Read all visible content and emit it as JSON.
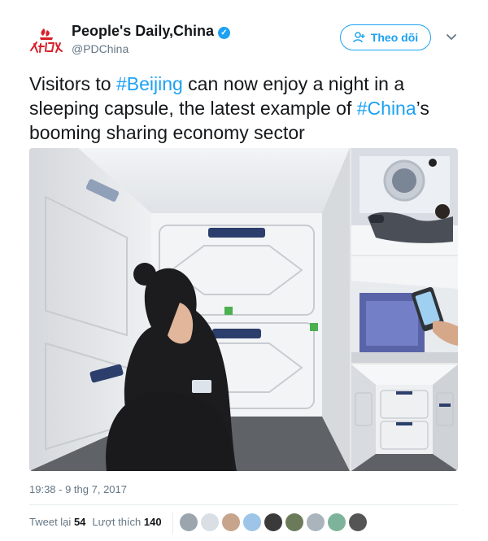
{
  "author": {
    "name": "People's Daily,China",
    "handle": "@PDChina",
    "verified_icon": "verified-badge-icon",
    "logo_icon": "peoples-daily-logo"
  },
  "follow_button": {
    "label": "Theo dõi",
    "icon": "add-user-icon"
  },
  "more_icon": "chevron-down-icon",
  "tweet": {
    "part1": "Visitors to ",
    "hashtag1": "#Beijing",
    "part2": " can now enjoy a night in a sleeping capsule, the latest example of ",
    "hashtag2": "#China",
    "part3": "’s booming sharing economy sector"
  },
  "media": {
    "main": "capsule-hotel-woman-photo",
    "side": [
      "man-in-capsule-photo",
      "capsule-interior-phone-photo",
      "capsule-corridor-photo"
    ]
  },
  "timestamp": "19:38 - 9 thg 7, 2017",
  "stats": {
    "retweets_label": "Tweet lại",
    "retweets": "54",
    "likes_label": "Lượt thích",
    "likes": "140"
  },
  "liker_avatars": [
    "#9aa5ad",
    "#d9dfe4",
    "#c7a48c",
    "#9ec5e8",
    "#3a3a3a",
    "#6b7b5a",
    "#aab4bc",
    "#7db39a",
    "#555555"
  ],
  "colors": {
    "accent": "#1da1f2",
    "text": "#14171a",
    "muted": "#657786"
  }
}
